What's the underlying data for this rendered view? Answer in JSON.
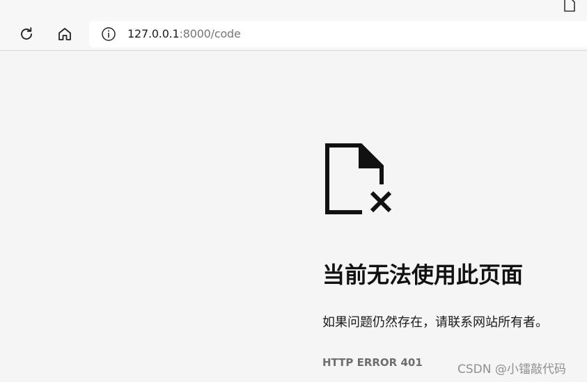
{
  "toolbar": {
    "url_host": "127.0.0.1",
    "url_rest": ":8000/code"
  },
  "error": {
    "title": "当前无法使用此页面",
    "description": "如果问题仍然存在，请联系网站所有者。",
    "code": "HTTP ERROR 401"
  },
  "watermark": {
    "text": "CSDN @小镭敲代码"
  },
  "icons": {
    "refresh": "refresh-icon",
    "home": "home-icon",
    "info": "info-icon",
    "page": "page-icon",
    "broken_file": "broken-file-icon"
  },
  "colors": {
    "page_background": "#f5f5f5",
    "toolbar_background": "#f7f7f7",
    "address_bar_background": "#ffffff",
    "title_text": "#111111",
    "muted_text": "#6e6e6e"
  }
}
